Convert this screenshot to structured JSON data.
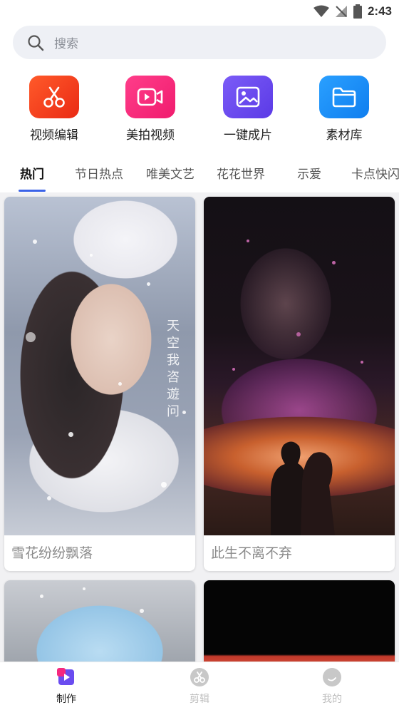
{
  "status_bar": {
    "time": "2:43"
  },
  "search": {
    "placeholder": "搜索"
  },
  "quick_actions": [
    {
      "label": "视频编辑",
      "icon": "scissors-icon",
      "color": "#f5421f"
    },
    {
      "label": "美拍视频",
      "icon": "video-camera-icon",
      "color": "#f5287f"
    },
    {
      "label": "一键成片",
      "icon": "image-icon",
      "color": "#6f4cf0"
    },
    {
      "label": "素材库",
      "icon": "folder-icon",
      "color": "#1a8cf5"
    }
  ],
  "tabs": [
    "热门",
    "节日热点",
    "唯美文艺",
    "花花世界",
    "示爱",
    "卡点快闪"
  ],
  "active_tab": "热门",
  "cards": [
    {
      "title": "雪花纷纷飘落",
      "overlay_text": "天空我咨遊问"
    },
    {
      "title": "此生不离不弃"
    },
    {
      "title": ""
    },
    {
      "title": ""
    }
  ],
  "bottom_nav": [
    {
      "label": "制作",
      "icon": "make-icon",
      "active": true
    },
    {
      "label": "剪辑",
      "icon": "scissors-icon",
      "active": false
    },
    {
      "label": "我的",
      "icon": "profile-icon",
      "active": false
    }
  ],
  "colors": {
    "accent": "#3b63e8"
  }
}
